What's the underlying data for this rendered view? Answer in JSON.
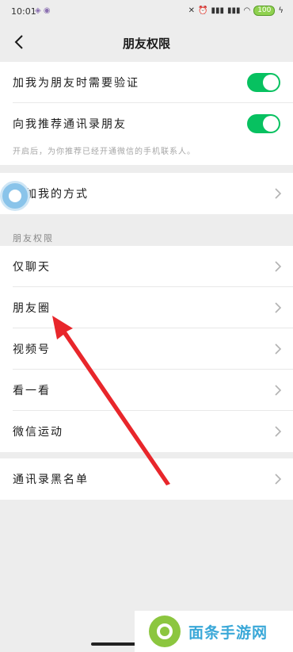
{
  "status_bar": {
    "time": "10:01",
    "battery": "100"
  },
  "header": {
    "title": "朋友权限"
  },
  "verification_card": {
    "items": [
      {
        "label": "加我为朋友时需要验证",
        "toggle_on": true
      },
      {
        "label": "向我推荐通讯录朋友",
        "toggle_on": true
      }
    ],
    "hint": "开启后，为你推荐已经开通微信的手机联系人。"
  },
  "add_methods": {
    "label": "添加我的方式"
  },
  "friend_permissions": {
    "section_label": "朋友权限",
    "items": [
      {
        "label": "仅聊天"
      },
      {
        "label": "朋友圈"
      },
      {
        "label": "视频号"
      },
      {
        "label": "看一看"
      },
      {
        "label": "微信运动"
      }
    ]
  },
  "blacklist": {
    "label": "通讯录黑名单"
  },
  "watermark": {
    "text": "面条手游网"
  },
  "colors": {
    "toggle_on": "#07c160",
    "arrow": "#e8262b",
    "background": "#ededed"
  }
}
